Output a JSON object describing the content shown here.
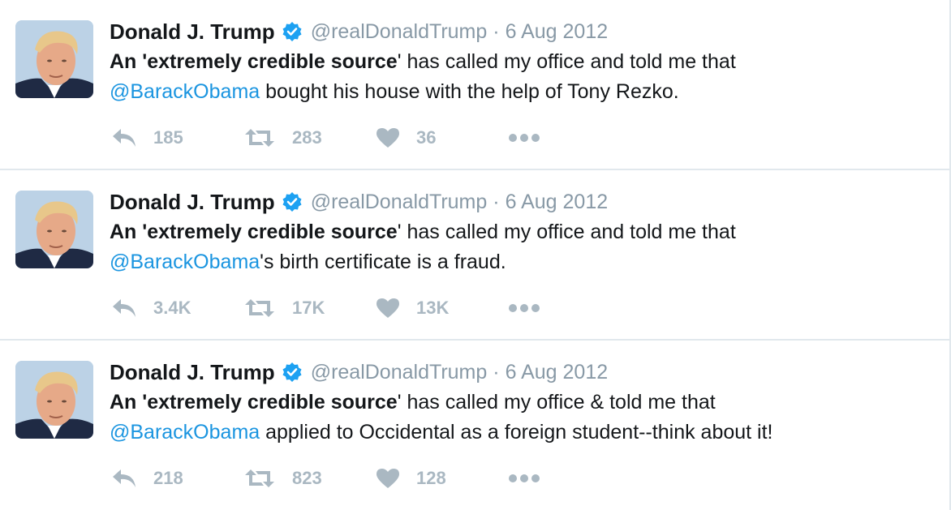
{
  "tweets": [
    {
      "name": "Donald J. Trump",
      "handle": "@realDonaldTrump",
      "separator": "·",
      "date": "6 Aug 2012",
      "text_bold": "An 'extremely credible source",
      "text_after_bold": "' has called my office and told me that",
      "mention": "@BarackObama",
      "text_tail": " bought his house with the help of Tony Rezko.",
      "replies": "185",
      "retweets": "283",
      "likes": "36"
    },
    {
      "name": "Donald J. Trump",
      "handle": "@realDonaldTrump",
      "separator": "·",
      "date": "6 Aug 2012",
      "text_bold": "An 'extremely credible source",
      "text_after_bold": "' has called my office and told me that",
      "mention": "@BarackObama",
      "text_tail": "'s birth certificate is a fraud.",
      "replies": "3.4K",
      "retweets": "17K",
      "likes": "13K"
    },
    {
      "name": "Donald J. Trump",
      "handle": "@realDonaldTrump",
      "separator": "·",
      "date": "6 Aug 2012",
      "text_bold": "An 'extremely credible source",
      "text_after_bold": "' has called my office & told me that",
      "mention": "@BarackObama",
      "text_tail": " applied to Occidental as a foreign student--think about it!",
      "replies": "218",
      "retweets": "823",
      "likes": "128"
    }
  ],
  "icons": {
    "reply": "reply-icon",
    "retweet": "retweet-icon",
    "like": "heart-icon",
    "more": "more-icon",
    "verified": "verified-badge-icon"
  },
  "colors": {
    "name": "#14171a",
    "secondary": "#8899a6",
    "mention": "#1b95e0",
    "action_icon": "#aab8c2",
    "verified": "#1da1f2",
    "divider": "#e1e8ed"
  }
}
